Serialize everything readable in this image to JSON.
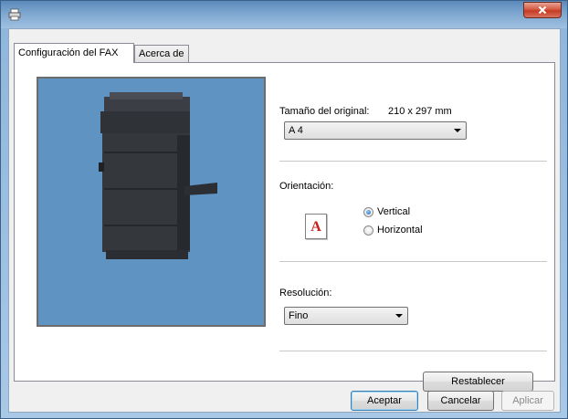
{
  "window": {
    "title": "",
    "close_label": "x",
    "icons": {
      "app": "printer-icon",
      "close": "close-icon"
    }
  },
  "tabs": [
    {
      "label": "Configuración del FAX",
      "active": true
    },
    {
      "label": "Acerca de",
      "active": false
    }
  ],
  "preview": {
    "icon": "multifunction-printer-image",
    "background": "#5f93c2"
  },
  "original_size": {
    "label": "Tamaño del original:",
    "dimensions": "210 x 297 mm",
    "selected": "A 4"
  },
  "orientation": {
    "label": "Orientación:",
    "icon_letter": "A",
    "options": [
      {
        "label": "Vertical",
        "checked": true
      },
      {
        "label": "Horizontal",
        "checked": false
      }
    ]
  },
  "resolution": {
    "label": "Resolución:",
    "selected": "Fino"
  },
  "buttons": {
    "reset": "Restablecer",
    "ok": "Aceptar",
    "cancel": "Cancelar",
    "apply": "Aplicar"
  },
  "colors": {
    "title_bar": "#7ea7d0",
    "close_button": "#c43b22",
    "preview_bg": "#5f93c2",
    "orientation_letter": "#c81e1e"
  }
}
